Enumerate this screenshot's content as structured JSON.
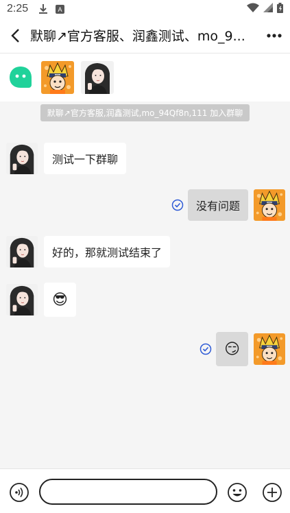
{
  "status_bar": {
    "time": "2:25",
    "icons": [
      "download-icon",
      "notification-a-icon",
      "wifi-icon",
      "signal-icon",
      "battery-icon"
    ]
  },
  "header": {
    "title": "默聊↗官方客服、润鑫测试、mo_9..."
  },
  "members": {
    "bot_icon": "chat-bot-icon",
    "avatars": [
      "ninja-avatar",
      "girl-avatar"
    ]
  },
  "system_notice": "默聊↗官方客服,润鑫测试,mo_94Qf8n,111 加入群聊",
  "messages": [
    {
      "side": "left",
      "avatar": "girl-avatar",
      "text": "测试一下群聊"
    },
    {
      "side": "right",
      "avatar": "ninja-avatar",
      "text": "没有问题",
      "read": true
    },
    {
      "side": "left",
      "avatar": "girl-avatar",
      "text": "好的，那就测试结束了"
    },
    {
      "side": "left",
      "avatar": "girl-avatar",
      "text": "😎"
    },
    {
      "side": "right",
      "avatar": "ninja-avatar",
      "text": "😏",
      "read": true
    }
  ],
  "input_bar": {
    "voice_icon": "voice-icon",
    "input_value": "",
    "emoji_icon": "emoji-icon",
    "add_icon": "plus-icon"
  },
  "colors": {
    "accent_green": "#20d29a",
    "read_check_blue": "#2f5bd6",
    "my_bubble": "#d9d9d9",
    "notice_bg": "#c9c9c9",
    "avatar_orange": "#f28a1c"
  }
}
